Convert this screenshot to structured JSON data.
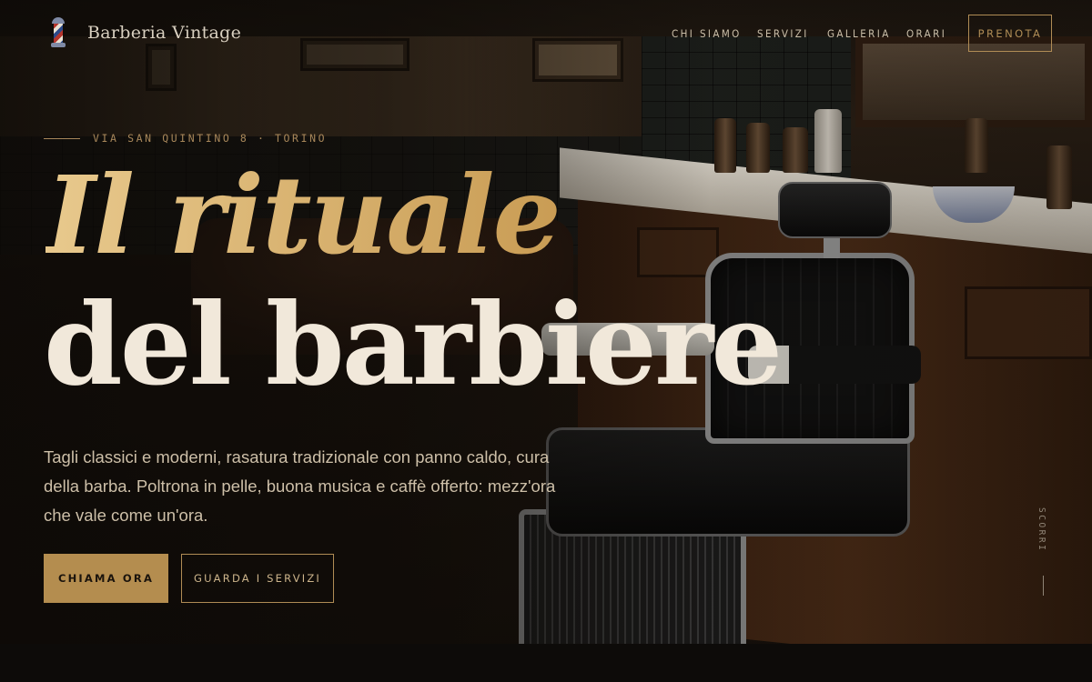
{
  "brand": {
    "name": "Barberia Vintage",
    "logo_icon": "barber-pole-icon"
  },
  "nav": {
    "items": [
      {
        "label": "CHI SIAMO"
      },
      {
        "label": "SERVIZI"
      },
      {
        "label": "GALLERIA"
      },
      {
        "label": "ORARI"
      }
    ],
    "book_label": "PRENOTA"
  },
  "hero": {
    "eyebrow": "VIA SAN QUINTINO 8 · TORINO",
    "title_line1": "Il rituale",
    "title_line2": "del barbiere",
    "description": "Tagli classici e moderni, rasatura tradizionale con panno caldo, cura della barba. Poltrona in pelle, buona musica e caffè offerto: mezz'ora che vale come un'ora.",
    "primary_cta": "CHIAMA ORA",
    "secondary_cta": "GUARDA I SERVIZI",
    "scroll_label": "SCORRI"
  },
  "colors": {
    "accent_gold": "#b48d4f",
    "title_gold": "#d9b56d",
    "background": "#0c0a08",
    "text_cream": "#f1e8da"
  }
}
